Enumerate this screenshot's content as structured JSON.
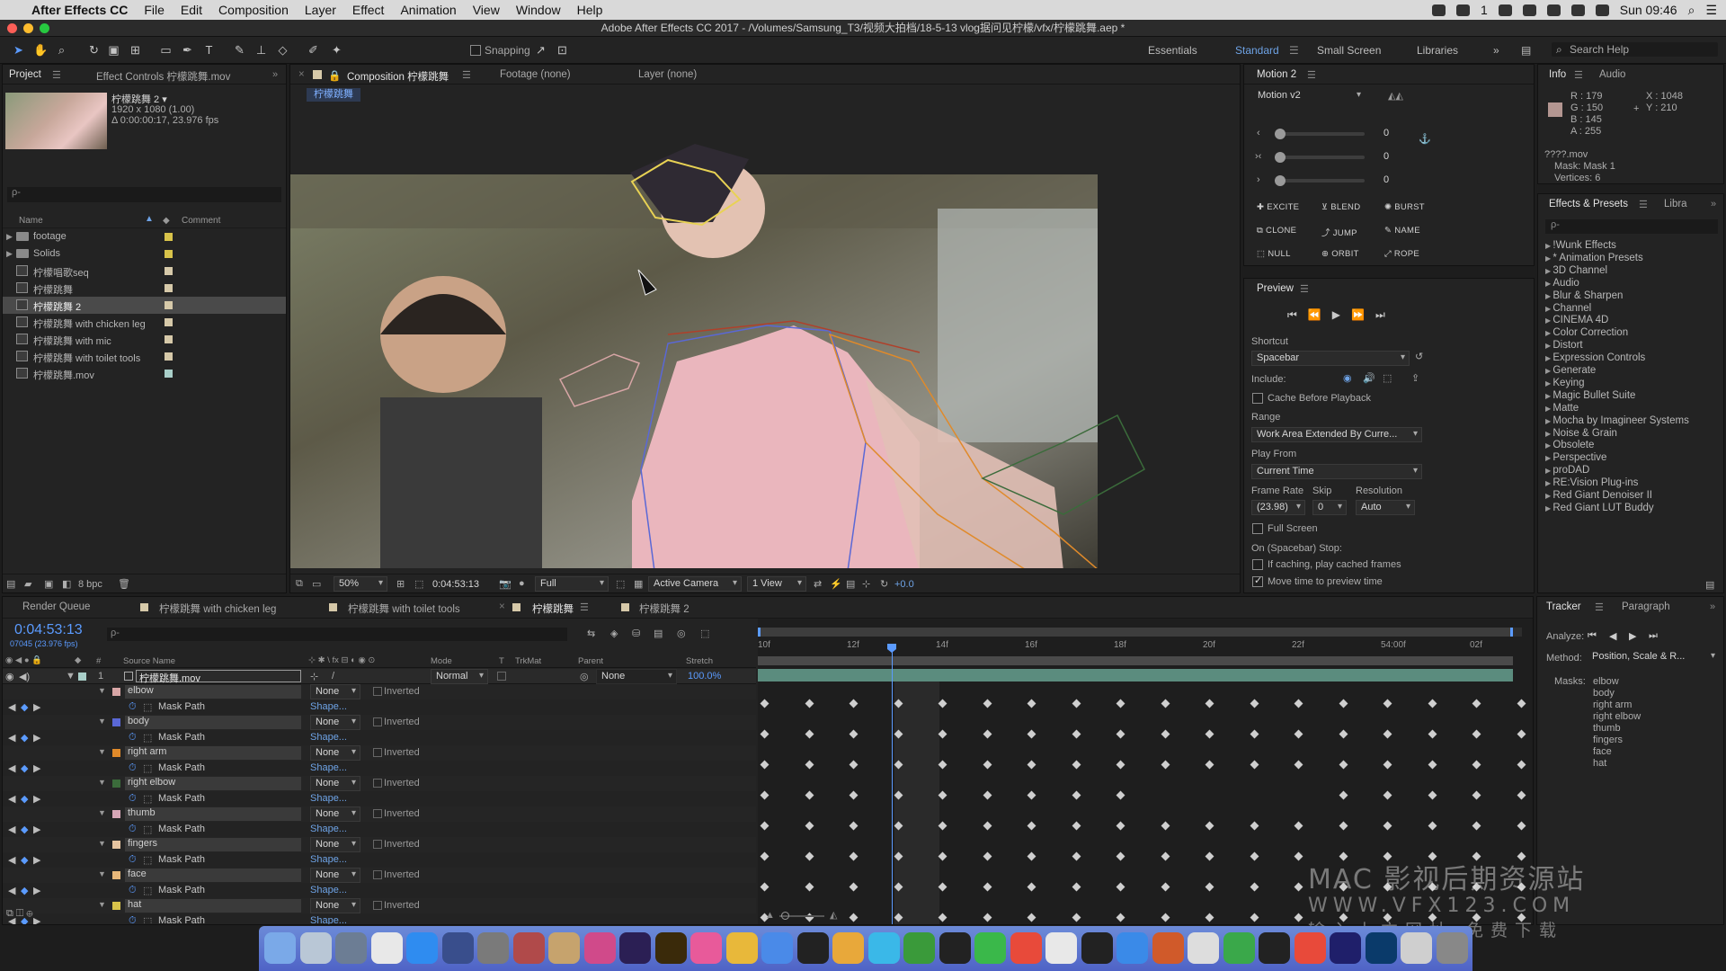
{
  "menubar": {
    "apple": "",
    "app": "After Effects CC",
    "items": [
      "File",
      "Edit",
      "Composition",
      "Layer",
      "Effect",
      "Animation",
      "View",
      "Window",
      "Help"
    ],
    "status": {
      "time": "Sun 09:46",
      "badge": "1"
    }
  },
  "title": "Adobe After Effects CC 2017 - /Volumes/Samsung_T3/视频大拍档/18-5-13 vlog据问见柠檬/vfx/柠檬跳舞.aep *",
  "toolbar": {
    "snapping": "Snapping",
    "workspaces": [
      "Essentials",
      "Standard",
      "Small Screen",
      "Libraries"
    ],
    "search": "Search Help"
  },
  "project": {
    "tabs": [
      "Project",
      "Effect Controls 柠檬跳舞.mov"
    ],
    "selected": {
      "name": "柠檬跳舞 2 ▾",
      "dims": "1920 x 1080 (1.00)",
      "duration": "Δ 0:00:00:17, 23.976 fps"
    },
    "search_placeholder": "ρ-",
    "columns": [
      "Name",
      "Comment"
    ],
    "items": [
      {
        "name": "footage",
        "type": "folder",
        "color": "#d8c34a"
      },
      {
        "name": "Solids",
        "type": "folder",
        "color": "#d8c34a"
      },
      {
        "name": "柠檬唱歌seq",
        "type": "comp",
        "color": "#d6c9a9"
      },
      {
        "name": "柠檬跳舞",
        "type": "comp",
        "color": "#d6c9a9"
      },
      {
        "name": "柠檬跳舞 2",
        "type": "comp",
        "color": "#d6c9a9"
      },
      {
        "name": "柠檬跳舞 with chicken leg",
        "type": "comp",
        "color": "#d6c9a9"
      },
      {
        "name": "柠檬跳舞 with mic",
        "type": "comp",
        "color": "#d6c9a9"
      },
      {
        "name": "柠檬跳舞 with toilet tools",
        "type": "comp",
        "color": "#d6c9a9"
      },
      {
        "name": "柠檬跳舞.mov",
        "type": "file",
        "color": "#a9cfc9"
      }
    ],
    "bpc": "8 bpc"
  },
  "viewer": {
    "tabs": [
      "Composition 柠檬跳舞",
      "Footage (none)",
      "Layer (none)"
    ],
    "subtab": "柠檬跳舞",
    "zoom": "50%",
    "timecode": "0:04:53:13",
    "resolution": "Full",
    "camera": "Active Camera",
    "views": "1 View",
    "exposure": "+0.0"
  },
  "motion": {
    "title": "Motion 2",
    "version": "Motion v2",
    "sliders": [
      "0",
      "0",
      "0"
    ],
    "buttons": [
      "EXCITE",
      "BLEND",
      "BURST",
      "CLONE",
      "JUMP",
      "NAME",
      "NULL",
      "ORBIT",
      "ROPE"
    ]
  },
  "preview": {
    "title": "Preview",
    "shortcut_label": "Shortcut",
    "shortcut": "Spacebar",
    "include": "Include:",
    "cache": "Cache Before Playback",
    "range_label": "Range",
    "range": "Work Area Extended By Curre...",
    "playfrom_label": "Play From",
    "playfrom": "Current Time",
    "fr_label": "Frame Rate",
    "skip_label": "Skip",
    "res_label": "Resolution",
    "fr": "(23.98)",
    "skip": "0",
    "res": "Auto",
    "fullscreen": "Full Screen",
    "stop_label": "On (Spacebar) Stop:",
    "ifcaching": "If caching, play cached frames",
    "movetime": "Move time to preview time"
  },
  "info": {
    "tabs": [
      "Info",
      "Audio"
    ],
    "r": "R : 179",
    "g": "G : 150",
    "b": "B : 145",
    "a": "A : 255",
    "x": "X : 1048",
    "y": "Y : 210",
    "file": "????.mov",
    "mask": "Mask: Mask 1",
    "vertices": "Vertices: 6",
    "swatch": "#b39691"
  },
  "effects": {
    "tabs": [
      "Effects & Presets",
      "Libra"
    ],
    "search": "ρ-",
    "items": [
      "!Wunk Effects",
      "* Animation Presets",
      "3D Channel",
      "Audio",
      "Blur & Sharpen",
      "Channel",
      "CINEMA 4D",
      "Color Correction",
      "Distort",
      "Expression Controls",
      "Generate",
      "Keying",
      "Magic Bullet Suite",
      "Matte",
      "Mocha by Imagineer Systems",
      "Noise & Grain",
      "Obsolete",
      "Perspective",
      "proDAD",
      "RE:Vision Plug-ins",
      "Red Giant Denoiser II",
      "Red Giant LUT Buddy"
    ]
  },
  "timeline": {
    "tabs": [
      "Render Queue",
      "柠檬跳舞 with chicken leg",
      "柠檬跳舞 with toilet tools",
      "柠檬跳舞",
      "柠檬跳舞 2"
    ],
    "timecode": "0:04:53:13",
    "frames": "07045 (23.976 fps)",
    "columns": [
      "#",
      "Source Name",
      "Mode",
      "T",
      "TrkMat",
      "Parent",
      "Stretch"
    ],
    "layer": {
      "num": "1",
      "name": "柠檬跳舞.mov",
      "mode": "Normal",
      "parent": "None",
      "stretch": "100.0%"
    },
    "masks": [
      {
        "name": "elbow",
        "mode": "None",
        "color": "#d8a6a6"
      },
      {
        "name": "body",
        "mode": "None",
        "color": "#5a68d6"
      },
      {
        "name": "right arm",
        "mode": "None",
        "color": "#e08a2a"
      },
      {
        "name": "right elbow",
        "mode": "None",
        "color": "#3b6b3b"
      },
      {
        "name": "thumb",
        "mode": "None",
        "color": "#d6a6b6"
      },
      {
        "name": "fingers",
        "mode": "None",
        "color": "#e6c4a0"
      },
      {
        "name": "face",
        "mode": "None",
        "color": "#e8b87a"
      },
      {
        "name": "hat",
        "mode": "None",
        "color": "#d8c34a"
      }
    ],
    "inverted": "Inverted",
    "maskpath": "Mask Path",
    "shape": "Shape...",
    "ruler": [
      "10f",
      "12f",
      "14f",
      "16f",
      "18f",
      "20f",
      "22f",
      "54:00f",
      "02f"
    ]
  },
  "tracker": {
    "tabs": [
      "Tracker",
      "Paragraph"
    ],
    "analyze": "Analyze:",
    "method_label": "Method:",
    "method": "Position, Scale & R...",
    "masks_label": "Masks:",
    "masks": [
      "elbow",
      "body",
      "right arm",
      "right elbow",
      "thumb",
      "fingers",
      "face",
      "hat"
    ]
  },
  "watermark": {
    "line1": "MAC 影视后期资源站",
    "line2": "WWW.VFX123.COM",
    "line3": "输入上方网址 免费下载"
  }
}
